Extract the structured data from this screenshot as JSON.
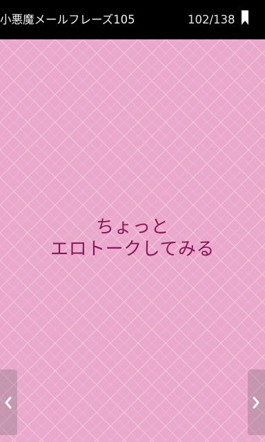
{
  "header": {
    "title": "小悪魔メールフレーズ105",
    "counter": "102/138",
    "bookmark_icon": "bookmark-icon"
  },
  "phrase": {
    "lines": [
      "ちょっと",
      "エロトークしてみる"
    ]
  },
  "navigation": {
    "prev_icon": "chevron-left-icon",
    "next_icon": "chevron-right-icon"
  },
  "colors": {
    "background": "#eaa8cc",
    "header": "#000000",
    "phrase_text": "#8a1658"
  }
}
